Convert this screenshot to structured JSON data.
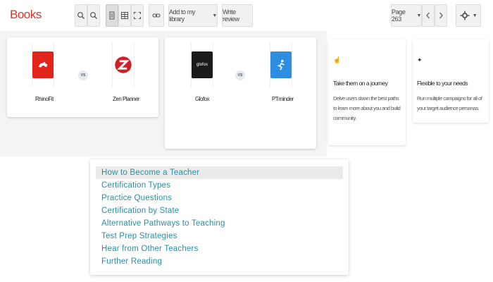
{
  "toolbar": {
    "title": "Books",
    "add_to_library_label": "Add to my library",
    "write_review_label": "Write review",
    "page_label": "Page 263"
  },
  "comparisons": [
    {
      "left": {
        "name": "RhinoFit",
        "color": "#e1251b"
      },
      "vs": "VS",
      "right": {
        "name": "Zen Planner",
        "color": "#d01f26"
      }
    },
    {
      "left": {
        "name": "Glofox",
        "color": "#1b1b1b"
      },
      "vs": "VS",
      "right": {
        "name": "PTminder",
        "color": "#2d8de0"
      }
    }
  ],
  "features": [
    {
      "icon": "hand-icon",
      "title": "Take them on a journey",
      "desc": "Delve users down the best paths to learn more about you and build community."
    },
    {
      "icon": "pin-icon",
      "title": "Flexible to your needs",
      "desc": "Run multiple campaigns for all of your target audience personas."
    }
  ],
  "menu": {
    "items": [
      "How to Become a Teacher",
      "Certification Types",
      "Practice Questions",
      "Certification by State",
      "Alternative Pathways to Teaching",
      "Test Prep Strategies",
      "Hear from Other Teachers",
      "Further Reading"
    ],
    "selected_index": 0
  },
  "colors": {
    "brand_red": "#d9342b",
    "link_teal": "#2a8ea3",
    "panel_bg": "#f4f4f4"
  }
}
